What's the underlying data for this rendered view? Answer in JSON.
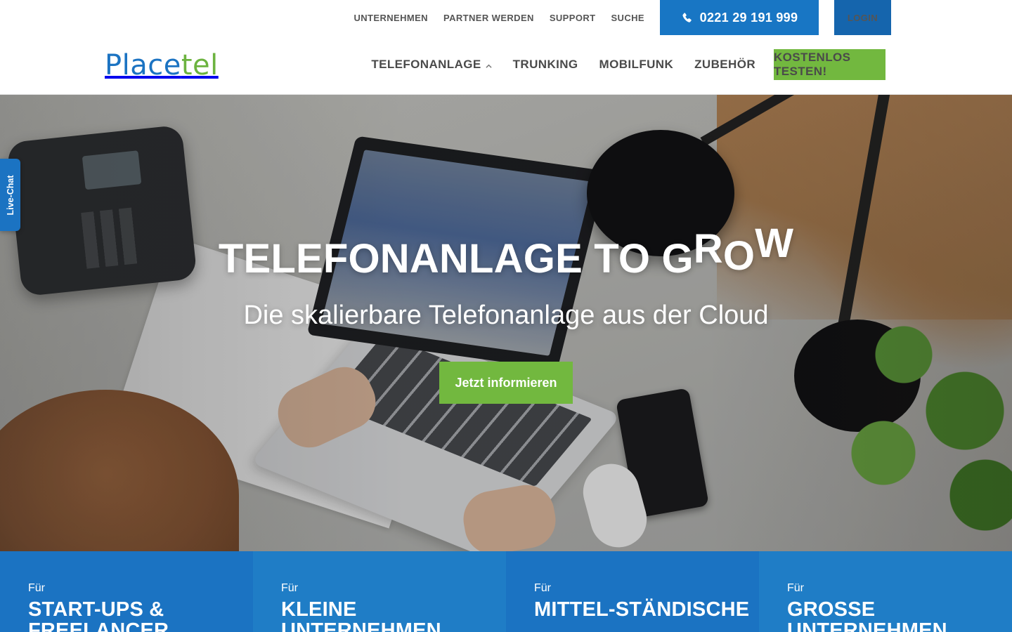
{
  "header": {
    "top_links": [
      "UNTERNEHMEN",
      "PARTNER WERDEN",
      "SUPPORT",
      "SUCHE"
    ],
    "phone": "0221 29 191 999",
    "login": "LOGIN",
    "logo_part1": "Place",
    "logo_part2": "tel",
    "main_nav": [
      "TELEFONANLAGE",
      "TRUNKING",
      "MOBILFUNK",
      "ZUBEHÖR"
    ],
    "cta": "KOSTENLOS TESTEN!"
  },
  "hero": {
    "title_main": "TELEFONANLAGE TO G",
    "title_r": "R",
    "title_o": "O",
    "title_w": "W",
    "subtitle": "Die skalierbare Telefonanlage aus der Cloud",
    "button": "Jetzt informieren"
  },
  "livechat": {
    "label": "Live-Chat"
  },
  "segments": [
    {
      "pre": "Für",
      "name": "START-UPS & FREELANCER",
      "color": "#1b73c2"
    },
    {
      "pre": "Für",
      "name": "KLEINE UNTERNEHMEN",
      "color": "#1f7dc6"
    },
    {
      "pre": "Für",
      "name": "MITTEL-STÄNDISCHE",
      "color": "#1b73c2"
    },
    {
      "pre": "Für",
      "name": "GROSSE UNTERNEHMEN",
      "color": "#1f7dc6"
    }
  ],
  "colors": {
    "brand_blue": "#1b73c2",
    "dark_blue": "#1565ad",
    "accent_green": "#72b83f"
  },
  "icons": {
    "phone": "phone-icon",
    "caret": "chevron-up-icon"
  }
}
